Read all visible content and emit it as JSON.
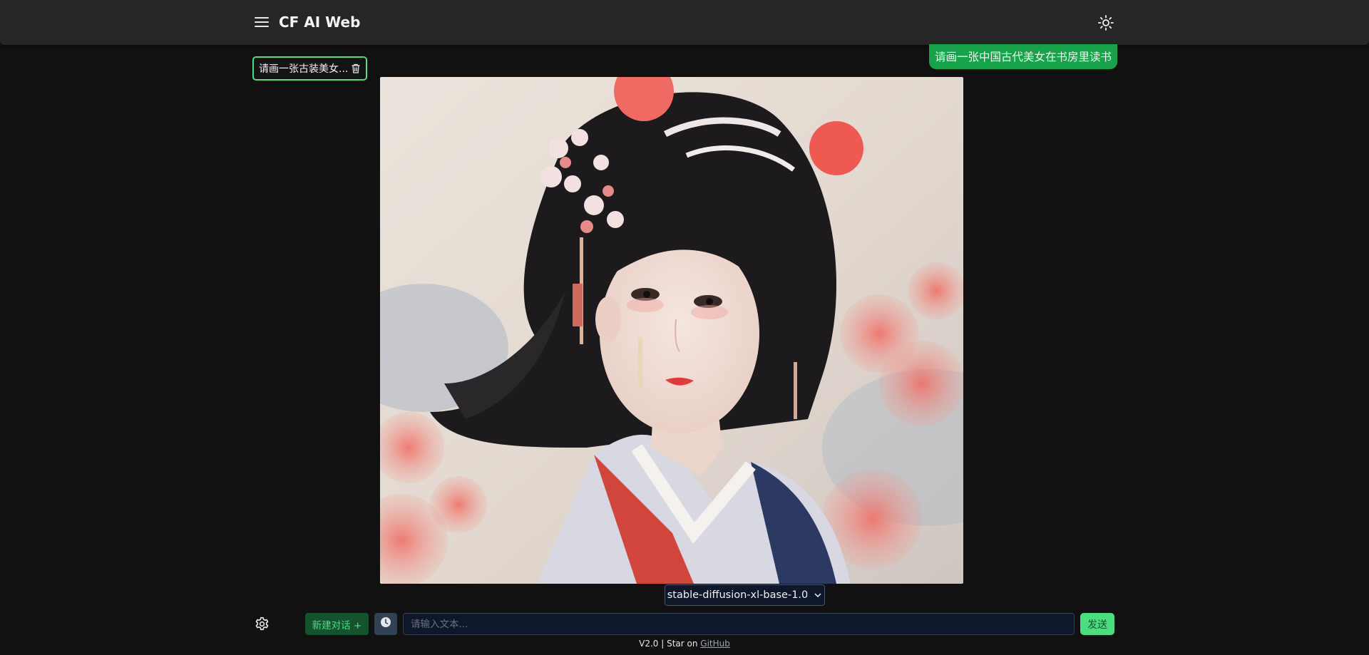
{
  "header": {
    "title": "CF AI Web",
    "menu_icon": "hamburger-menu-icon",
    "theme_icon": "sun-icon"
  },
  "sidebar": {
    "chats": [
      {
        "label": "请画一张古装美女...",
        "icon": "trash-icon"
      }
    ]
  },
  "conversation": {
    "user_message": "请画一张中国古代美女在书房里读书",
    "image_alt": "AI generated image: ancient Chinese beauty with flower hair ornaments"
  },
  "model_selector": {
    "selected": "stable-diffusion-xl-base-1.0"
  },
  "composer": {
    "new_chat_label": "新建对话 +",
    "input_placeholder": "请输入文本...",
    "input_value": "",
    "send_label": "发送"
  },
  "footer": {
    "version_text": "V2.0 | Star on ",
    "link_text": "GitHub"
  },
  "colors": {
    "background": "#111111",
    "header": "#262626",
    "accent_green": "#16a34a",
    "accent_light_green": "#4ade80",
    "input_bg": "#0f172a"
  }
}
